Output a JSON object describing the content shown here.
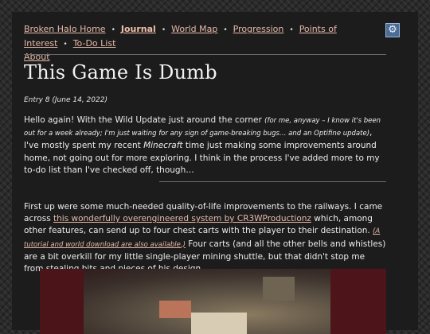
{
  "nav": {
    "items": [
      {
        "label": "Broken Halo Home",
        "active": false
      },
      {
        "label": "Journal",
        "active": true
      },
      {
        "label": "World Map",
        "active": false
      },
      {
        "label": "Progression",
        "active": false
      },
      {
        "label": "Points of Interest",
        "active": false
      },
      {
        "label": "To-Do List",
        "active": false
      }
    ],
    "about": "About",
    "separator": "•"
  },
  "settings": {
    "icon": "gear-icon",
    "glyph": "⚙"
  },
  "post": {
    "title": "This Game Is Dumb",
    "meta": "Entry 8 (June 14, 2022)",
    "p1": {
      "a": "Hello again! With the Wild Update just around the corner ",
      "aside": "(for me, anyway – I know it's been out for a week already; I'm just waiting for any sign of game-breaking bugs… and an Optifine update)",
      "b": ", I've mostly spent my recent ",
      "game": "Minecraft",
      "c": " time just making some improvements around home, not going out for more exploring. I think in the process I've added more to my to-do list than I've checked off, though…"
    },
    "p2": {
      "a": "First up were some much-needed quality-of-life improvements to the railways. I came across ",
      "link": "this wonderfully overengineered system by CR3WProductionz",
      "b": " which, among other features, can send up to four chest carts with the player to their destination. ",
      "link2": "(A tutorial and world download are also available.)",
      "c": " Four carts (and all the other bells and whistles) are a bit overkill for my little single-player mining shuttle, but that didn't stop me from stealing bits and pieces of his design."
    }
  },
  "colors": {
    "link": "#e6b9a8",
    "panel": "#1c1c1c",
    "gear_bg": "#4a6d98"
  }
}
